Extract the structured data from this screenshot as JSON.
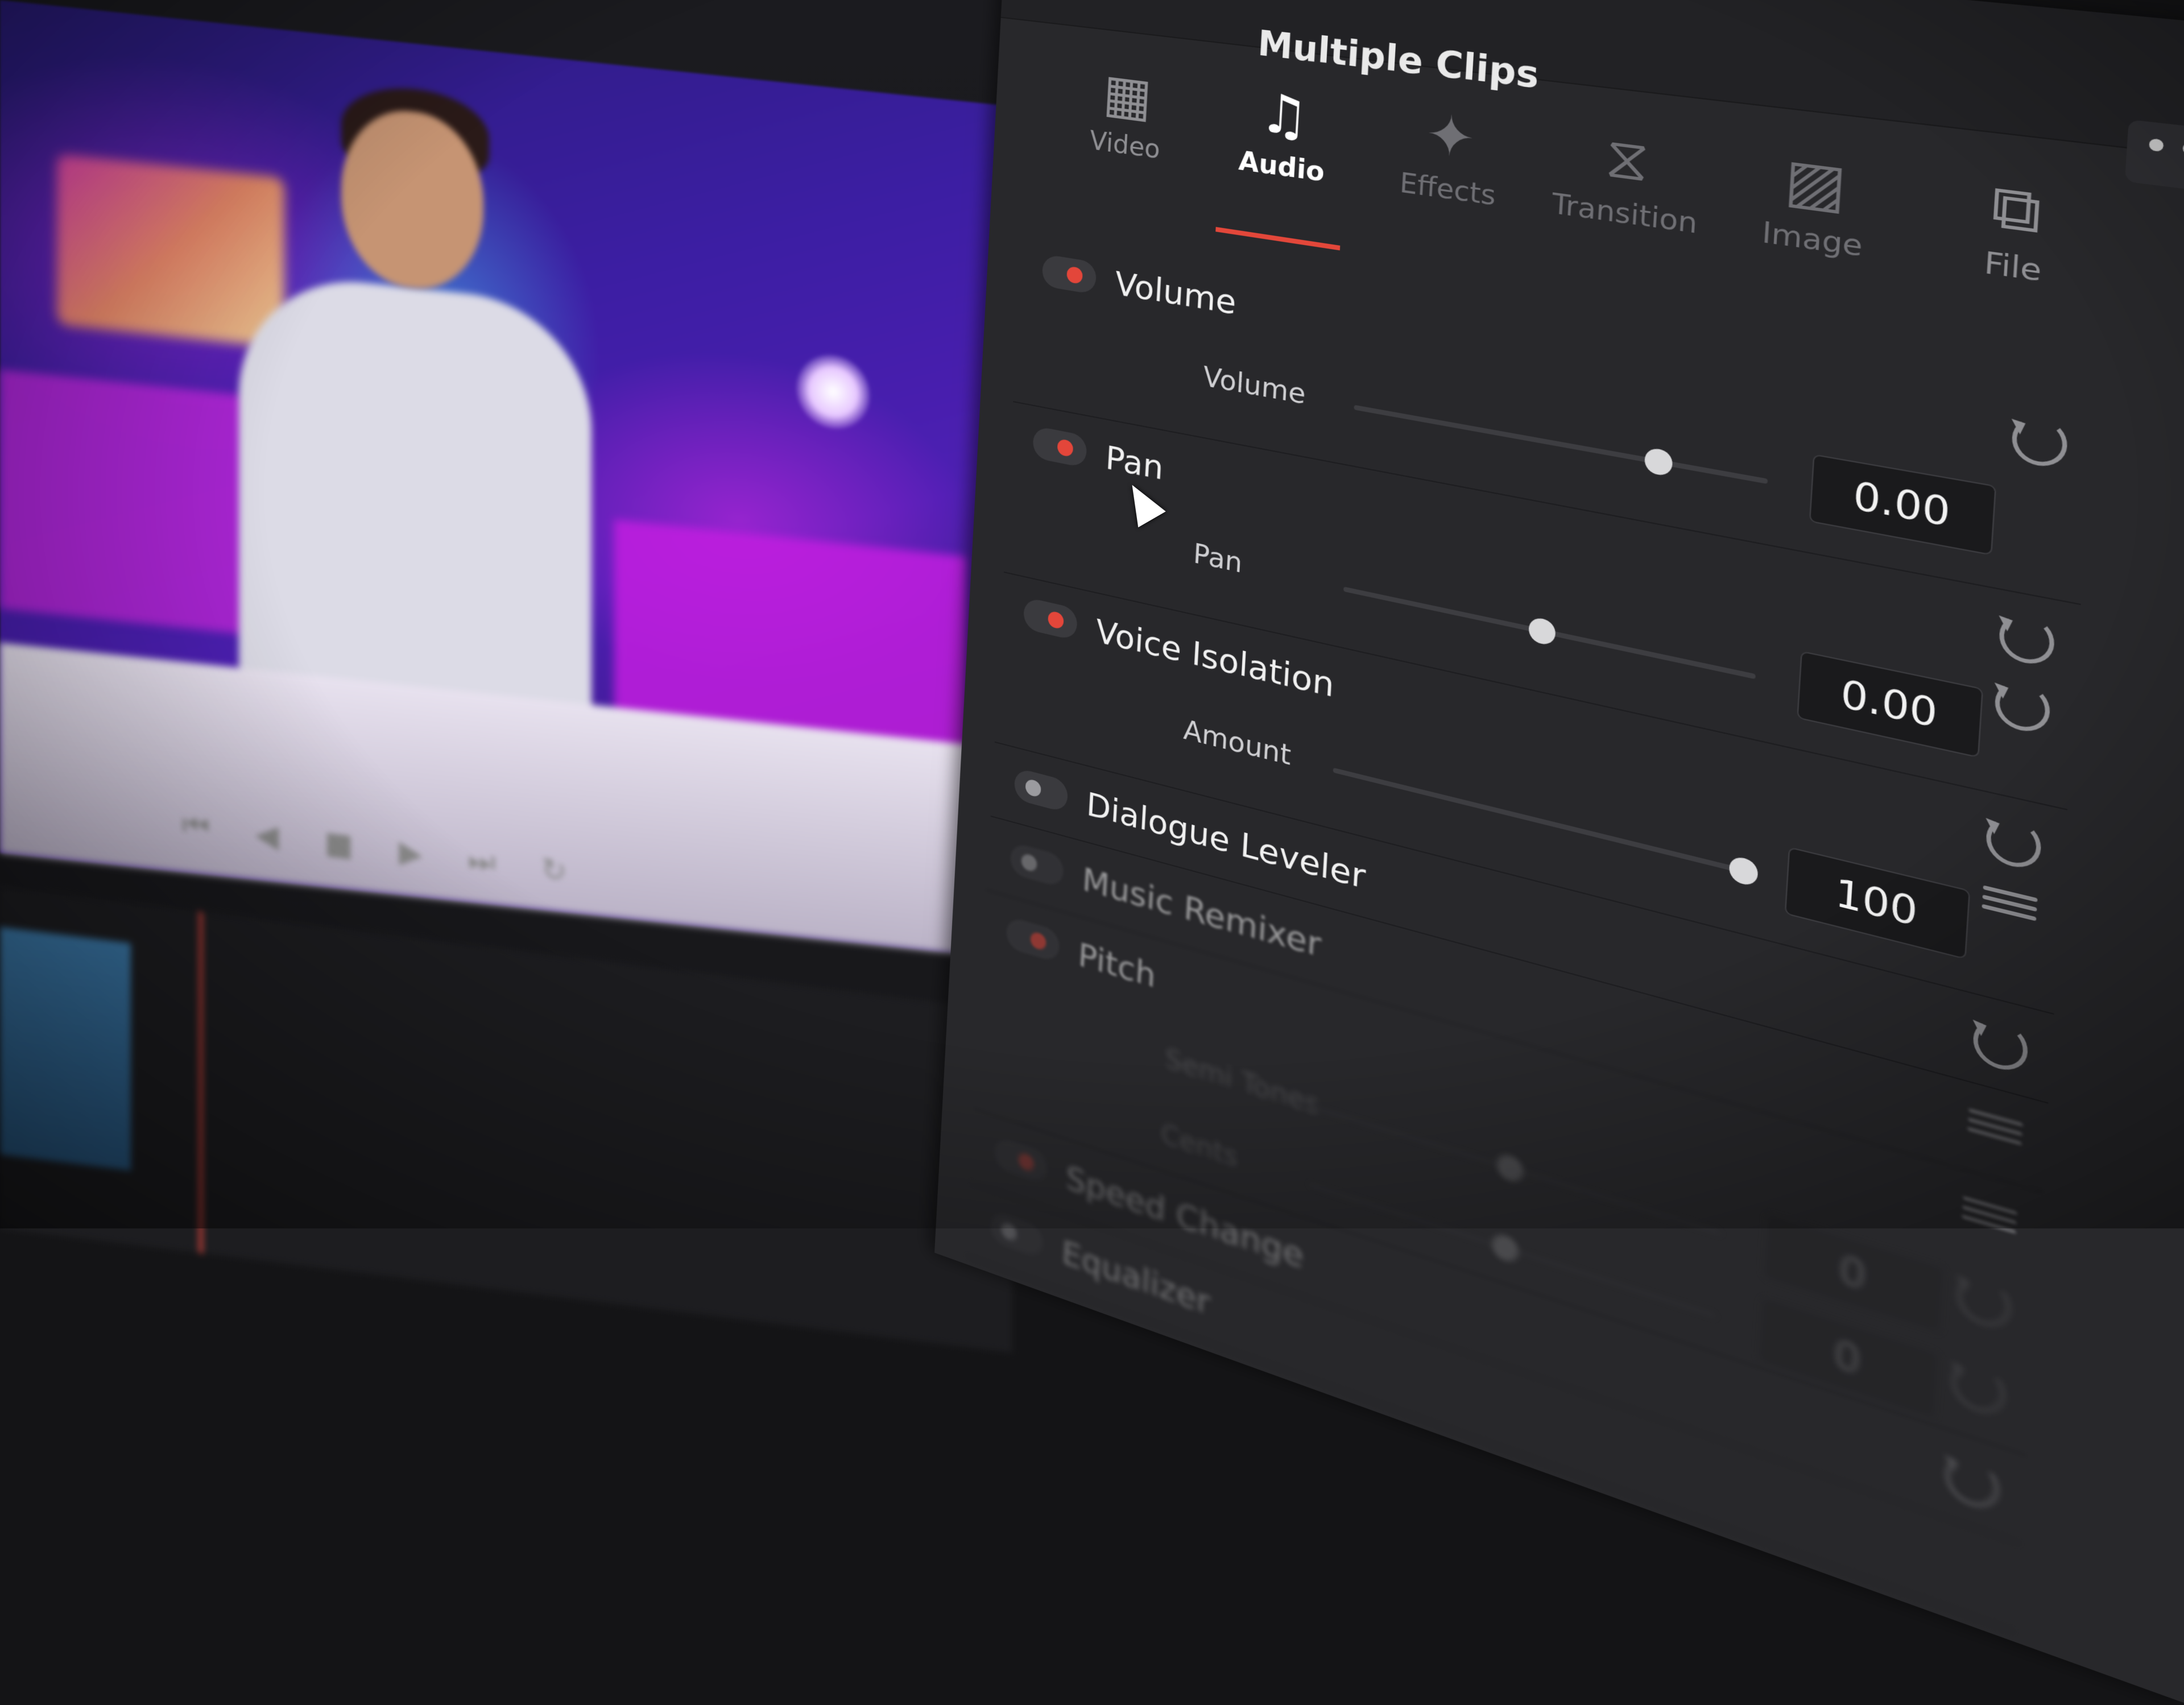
{
  "window": {
    "title": "Multiple Clips",
    "more_label": "•••"
  },
  "tabs": [
    {
      "label": "Video",
      "icon": "film-strip-icon",
      "glyph": "▦",
      "state": "normal"
    },
    {
      "label": "Audio",
      "icon": "music-note-icon",
      "glyph": "♫",
      "state": "active"
    },
    {
      "label": "Effects",
      "icon": "magic-wand-icon",
      "glyph": "✦",
      "state": "dim"
    },
    {
      "label": "Transition",
      "icon": "transition-icon",
      "glyph": "⧖",
      "state": "dim"
    },
    {
      "label": "Image",
      "icon": "image-icon",
      "glyph": "▨",
      "state": "dim"
    },
    {
      "label": "File",
      "icon": "file-icon",
      "glyph": "⧉",
      "state": "normal"
    }
  ],
  "sections": {
    "volume": {
      "title": "Volume",
      "enabled": true,
      "param": "Volume",
      "value": "0.00",
      "slider": 0.75
    },
    "pan": {
      "title": "Pan",
      "enabled": true,
      "param": "Pan",
      "value": "0.00",
      "slider": 0.5
    },
    "voice_isolation": {
      "title": "Voice Isolation",
      "enabled": true,
      "param": "Amount",
      "value": "100",
      "slider": 1.0
    },
    "dialogue_leveler": {
      "title": "Dialogue Leveler",
      "enabled": false
    },
    "music_remixer": {
      "title": "Music Remixer",
      "enabled": false
    },
    "pitch": {
      "title": "Pitch",
      "enabled": true,
      "param1": "Semi Tones",
      "param2": "Cents",
      "value1": "0",
      "value2": "0",
      "slider1": 0.5,
      "slider2": 0.5
    },
    "speed_change": {
      "title": "Speed Change",
      "enabled": true
    },
    "equalizer": {
      "title": "Equalizer",
      "enabled": false
    }
  },
  "colors": {
    "accent": "#e3473a",
    "panel": "#28282b",
    "header": "#222225"
  }
}
